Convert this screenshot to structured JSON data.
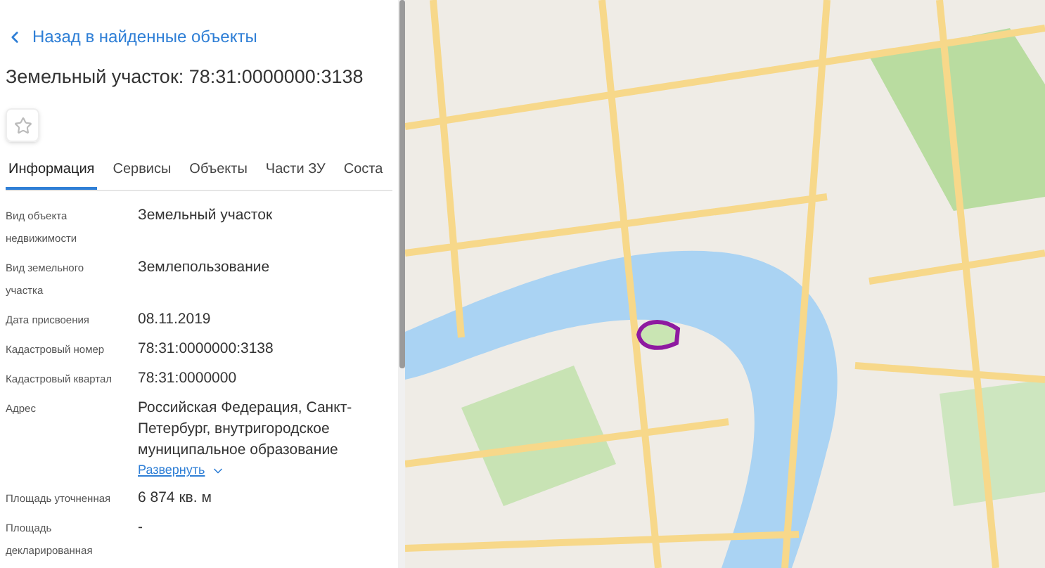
{
  "back_link": "Назад в найденные объекты",
  "title": "Земельный участок: 78:31:0000000:3138",
  "favorite": {
    "on": false
  },
  "tabs": [
    {
      "label": "Информация",
      "selected": true
    },
    {
      "label": "Сервисы",
      "selected": false
    },
    {
      "label": "Объекты",
      "selected": false
    },
    {
      "label": "Части ЗУ",
      "selected": false
    },
    {
      "label": "Соста",
      "selected": false
    }
  ],
  "fields": [
    {
      "label": "Вид объекта недвижимости",
      "value": "Земельный участок"
    },
    {
      "label": "Вид земельного участка",
      "value": "Землепользование"
    },
    {
      "label": "Дата присвоения",
      "value": "08.11.2019"
    },
    {
      "label": "Кадастровый номер",
      "value": "78:31:0000000:3138"
    },
    {
      "label": "Кадастровый квартал",
      "value": "78:31:0000000"
    },
    {
      "label": "Адрес",
      "value": "Российская Федерация, Санкт-Петербург, внутригородское муниципальное образование",
      "expand_link": "Развернуть"
    },
    {
      "label": "Площадь уточненная",
      "value": "6 874 кв. м"
    },
    {
      "label": "Площадь декларированная",
      "value": "-"
    }
  ]
}
